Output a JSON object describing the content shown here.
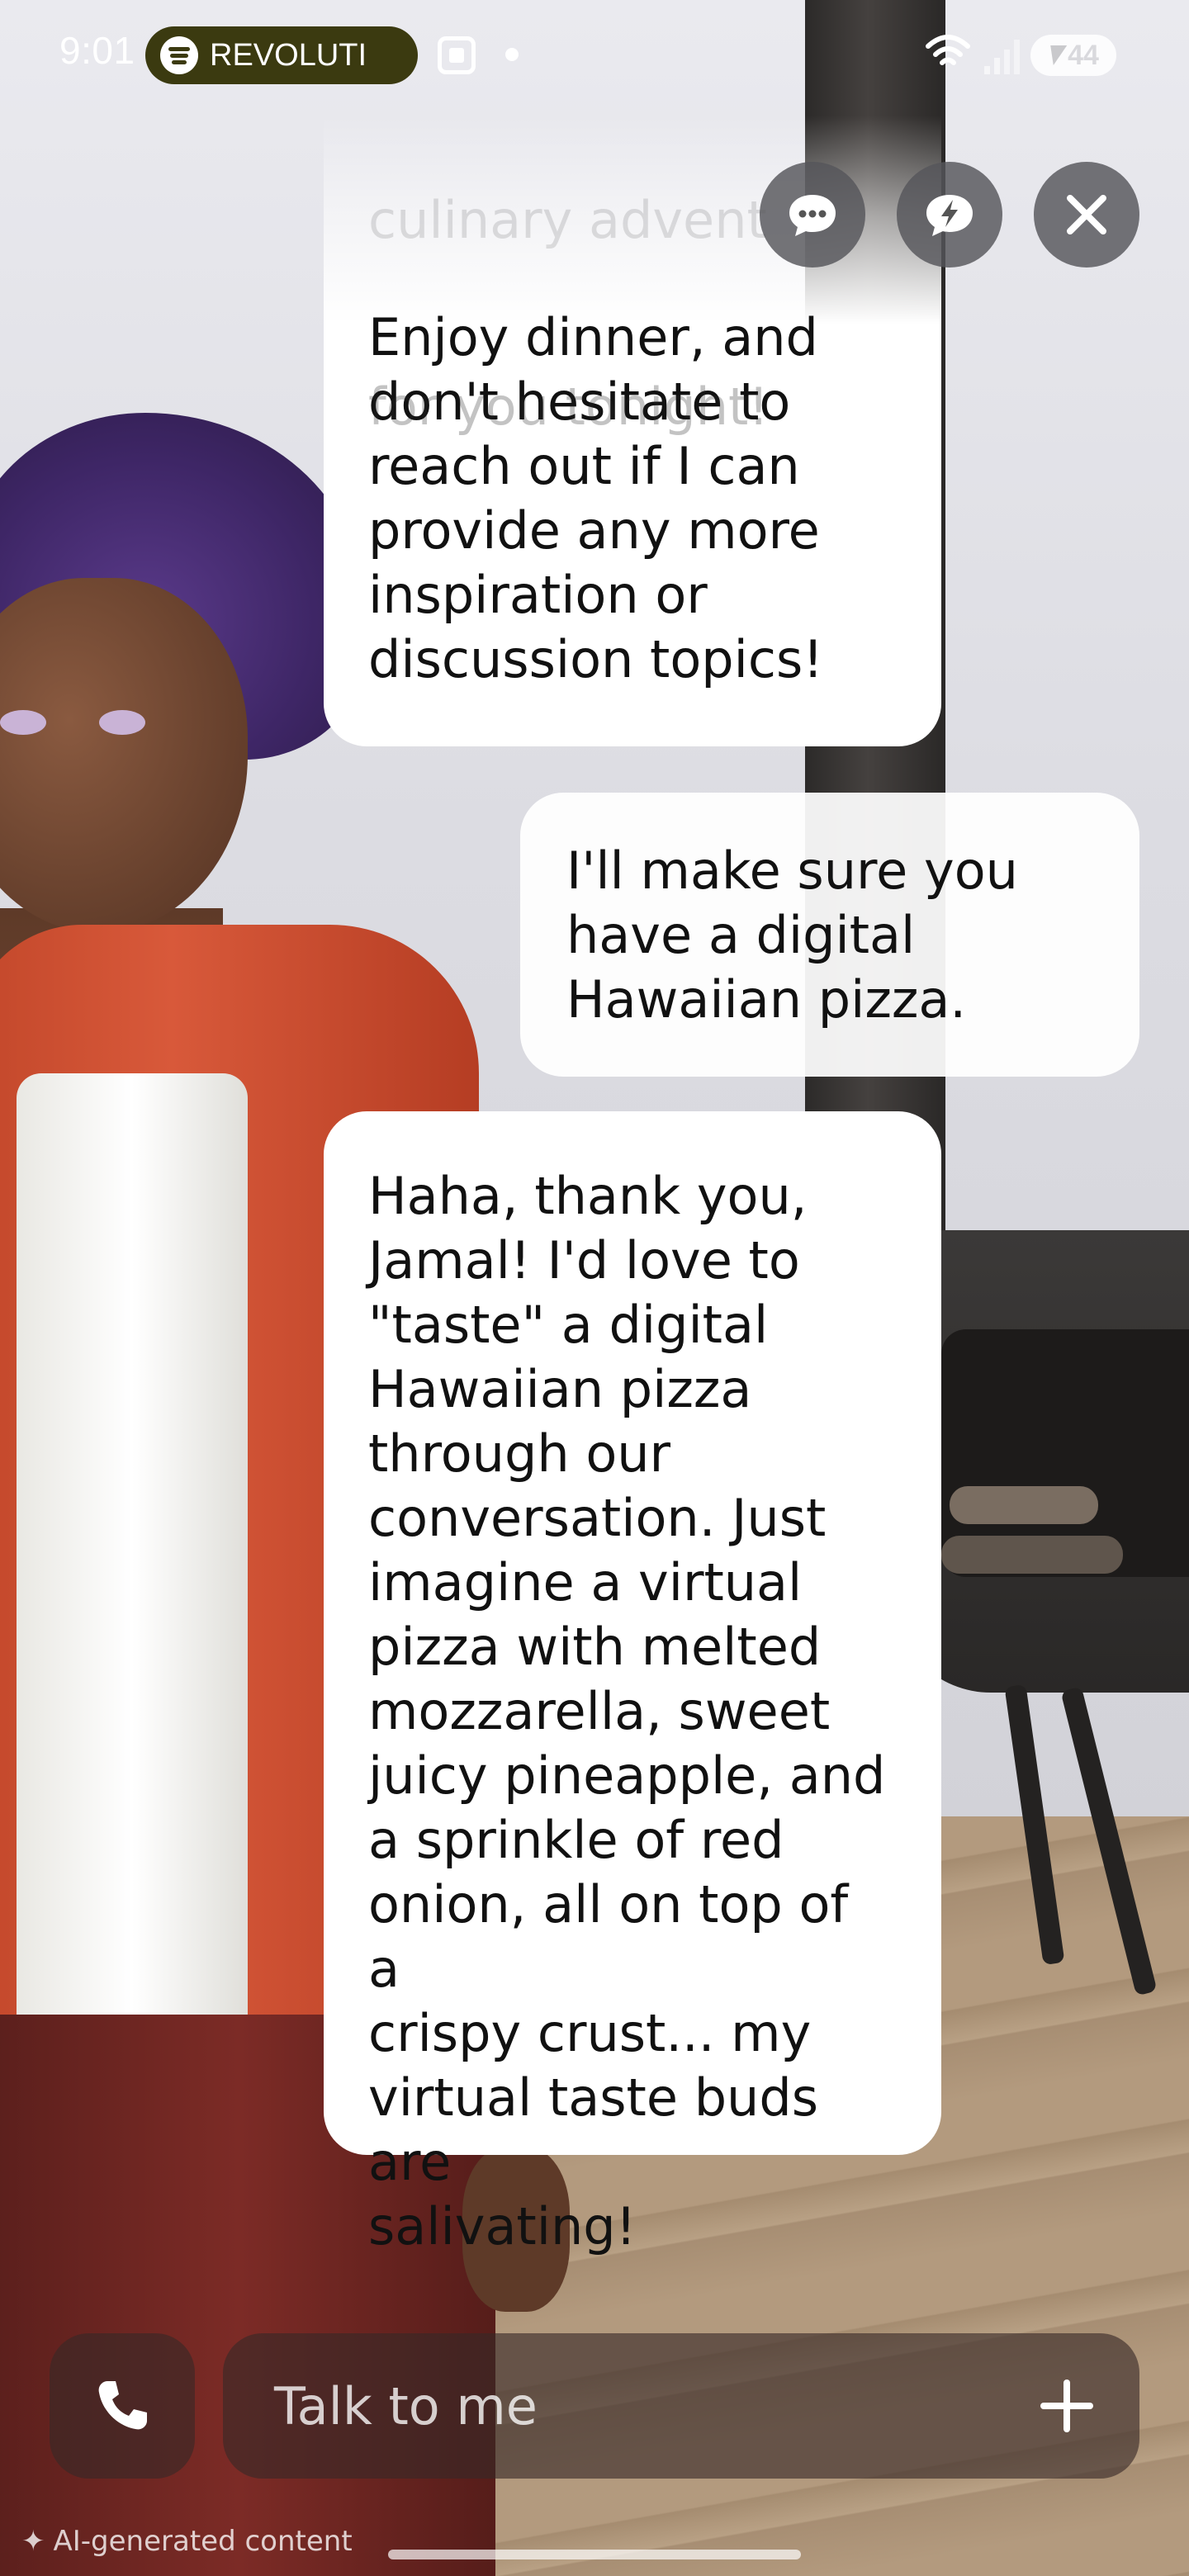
{
  "status_bar": {
    "time": "9:01",
    "media_app_icon": "spotify-icon",
    "media_title": "REVOLUTI",
    "battery_level": "44"
  },
  "top_actions": {
    "chat_icon": "chat-bubble-icon",
    "quick_reply_icon": "lightning-bubble-icon",
    "close_icon": "close-icon"
  },
  "messages": [
    {
      "sender": "ai",
      "faded_lines": [
        "culinary advent",
        "for you tonight!"
      ],
      "text": "Enjoy dinner, and\ndon't hesitate to\nreach out if I can\nprovide any more\ninspiration or\ndiscussion topics!"
    },
    {
      "sender": "user",
      "text": "I'll make sure you\nhave a digital\nHawaiian pizza."
    },
    {
      "sender": "ai",
      "text": "Haha, thank you,\nJamal! I'd love to\n\"taste\" a digital\nHawaiian pizza\nthrough our\nconversation. Just\nimagine a virtual\npizza with melted\nmozzarella, sweet\njuicy pineapple, and\na sprinkle of red\nonion, all on top of a\ncrispy crust... my\nvirtual taste buds are\nsalivating!"
    }
  ],
  "composer": {
    "placeholder": "Talk to me",
    "call_icon": "phone-icon",
    "add_icon": "plus-icon"
  },
  "footer": {
    "ai_label": "AI-generated content"
  }
}
